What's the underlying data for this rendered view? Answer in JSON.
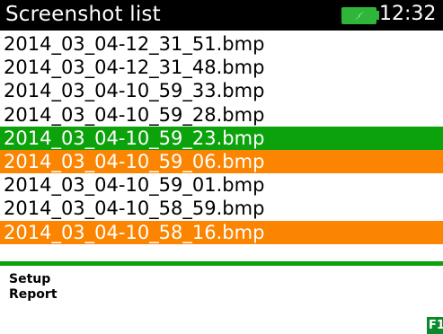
{
  "title_bar": {
    "title": "Screenshot list",
    "clock": "12:32",
    "battery_icon": "battery-charging-icon",
    "battery_color": "#2fb53a"
  },
  "colors": {
    "selected_row": "#0ba20b",
    "marked_row": "#fb8400",
    "separator": "#0ba20b"
  },
  "files": [
    {
      "name": "2014_03_04-12_31_51.bmp",
      "state": "normal"
    },
    {
      "name": "2014_03_04-12_31_48.bmp",
      "state": "normal"
    },
    {
      "name": "2014_03_04-10_59_33.bmp",
      "state": "normal"
    },
    {
      "name": "2014_03_04-10_59_28.bmp",
      "state": "normal"
    },
    {
      "name": "2014_03_04-10_59_23.bmp",
      "state": "selected"
    },
    {
      "name": "2014_03_04-10_59_06.bmp",
      "state": "marked"
    },
    {
      "name": "2014_03_04-10_59_01.bmp",
      "state": "normal"
    },
    {
      "name": "2014_03_04-10_58_59.bmp",
      "state": "normal"
    },
    {
      "name": "2014_03_04-10_58_16.bmp",
      "state": "marked"
    }
  ],
  "menu": {
    "setup_label": "Setup",
    "report_label": "Report"
  },
  "soft_key": {
    "label": "F1"
  }
}
